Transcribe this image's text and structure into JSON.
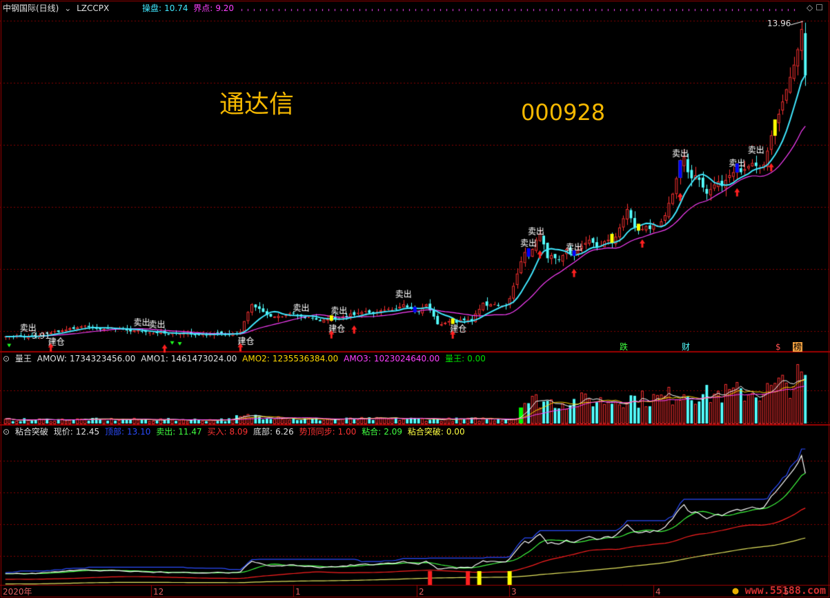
{
  "window": {
    "stock_name": "中钢国际(日线)",
    "indicator": "LZCCPX"
  },
  "overlays": {
    "software_name": "通达信",
    "stock_code": "000928",
    "watermark": "www.55188.com"
  },
  "panel_main": {
    "label_caopan": "操盘:",
    "value_caopan": "10.74",
    "label_jiedian": "界点:",
    "value_jiedian": "9.20",
    "high_label": "13.96",
    "low_label": "3.91",
    "signal_sell": "卖出",
    "signal_build": "建仓",
    "tags": [
      "跌",
      "财",
      "$",
      "榜"
    ]
  },
  "panel_volume": {
    "name": "量王",
    "label_amow": "AMOW:",
    "value_amow": "1734323456.00",
    "label_amo1": "AMO1:",
    "value_amo1": "1461473024.00",
    "label_amo2": "AMO2:",
    "value_amo2": "1235536384.00",
    "label_amo3": "AMO3:",
    "value_amo3": "1023024640.00",
    "label_lw": "量王:",
    "value_lw": "0.00"
  },
  "panel_break": {
    "name": "粘合突破",
    "label_price": "现价:",
    "value_price": "12.45",
    "label_top": "顶部:",
    "value_top": "13.10",
    "label_sell": "卖出:",
    "value_sell": "11.47",
    "label_buy": "买入:",
    "value_buy": "8.09",
    "label_bottom": "底部:",
    "value_bottom": "6.26",
    "label_sync": "势顶同步:",
    "value_sync": "1.00",
    "label_nian": "粘合:",
    "value_nian": "2.09",
    "label_tupo": "粘合突破:",
    "value_tupo": "0.00"
  },
  "colors": {
    "background": "#000000",
    "up": "#ff3232",
    "down": "#54ffff",
    "ma_fast": "#40e8ff",
    "ma_slow": "#ff40ff",
    "grid": "#8c0000",
    "signal_yellow": "#ffff00",
    "signal_blue": "#0000ff",
    "signal_green": "#00e000"
  },
  "chart_data": {
    "type": "candlestick",
    "x_ticks": [
      "2020年",
      "12",
      "1",
      "2",
      "3",
      "4",
      "5"
    ],
    "price_range": [
      3.5,
      14.5
    ],
    "close": [
      3.95,
      3.95,
      3.95,
      3.98,
      3.96,
      3.92,
      3.95,
      3.98,
      3.96,
      4.0,
      4.05,
      4.05,
      4.08,
      4.12,
      4.1,
      4.15,
      4.18,
      4.22,
      4.2,
      4.25,
      4.28,
      4.3,
      4.26,
      4.22,
      4.2,
      4.18,
      4.2,
      4.22,
      4.25,
      4.22,
      4.2,
      4.18,
      4.15,
      4.12,
      4.15,
      4.15,
      4.12,
      4.1,
      4.08,
      4.05,
      4.08,
      4.1,
      4.05,
      4.02,
      4.05,
      4.05,
      4.05,
      4.08,
      4.05,
      4.02,
      4.0,
      4.0,
      4.02,
      4.0,
      4.02,
      4.05,
      4.08,
      4.05,
      4.02,
      4.0,
      4.05,
      4.05,
      4.1,
      4.45,
      4.75,
      5.0,
      4.9,
      4.85,
      4.75,
      4.65,
      4.6,
      4.6,
      4.62,
      4.6,
      4.65,
      4.7,
      4.7,
      4.62,
      4.6,
      4.55,
      4.58,
      4.55,
      4.5,
      4.45,
      4.5,
      4.52,
      4.55,
      4.52,
      4.55,
      4.6,
      4.58,
      4.7,
      4.65,
      4.72,
      4.75,
      4.78,
      4.72,
      4.7,
      4.75,
      4.8,
      4.82,
      4.85,
      4.82,
      4.85,
      4.92,
      5.0,
      4.9,
      4.85,
      4.8,
      4.75,
      4.9,
      5.0,
      4.8,
      4.6,
      4.35,
      4.35,
      4.4,
      4.45,
      4.45,
      4.4,
      4.5,
      4.48,
      4.5,
      4.45,
      4.7,
      4.85,
      5.05,
      4.95,
      5.0,
      5.0,
      4.95,
      4.95,
      4.95,
      5.2,
      5.6,
      6.0,
      6.4,
      6.7,
      6.55,
      6.8,
      7.1,
      7.3,
      6.95,
      6.5,
      6.6,
      6.5,
      6.45,
      6.6,
      6.8,
      6.65,
      6.6,
      6.75,
      6.9,
      7.0,
      7.1,
      7.0,
      6.85,
      6.9,
      7.05,
      7.1,
      7.0,
      7.2,
      7.5,
      7.8,
      8.1,
      7.8,
      7.5,
      7.4,
      7.45,
      7.55,
      7.45,
      7.6,
      7.55,
      7.7,
      7.9,
      8.3,
      8.6,
      9.1,
      9.5,
      9.8,
      9.3,
      9.1,
      9.2,
      9.05,
      8.8,
      8.6,
      8.75,
      8.9,
      9.0,
      8.85,
      9.05,
      9.2,
      9.3,
      9.4,
      9.3,
      9.4,
      9.5,
      9.6,
      9.5,
      9.45,
      9.55,
      10.0,
      10.5,
      10.8,
      11.2,
      11.6,
      12.0,
      12.4,
      12.8,
      13.3,
      13.96,
      12.45
    ],
    "volume_label": "amount",
    "ma_fast_label": "操盘",
    "ma_slow_label": "界点"
  }
}
